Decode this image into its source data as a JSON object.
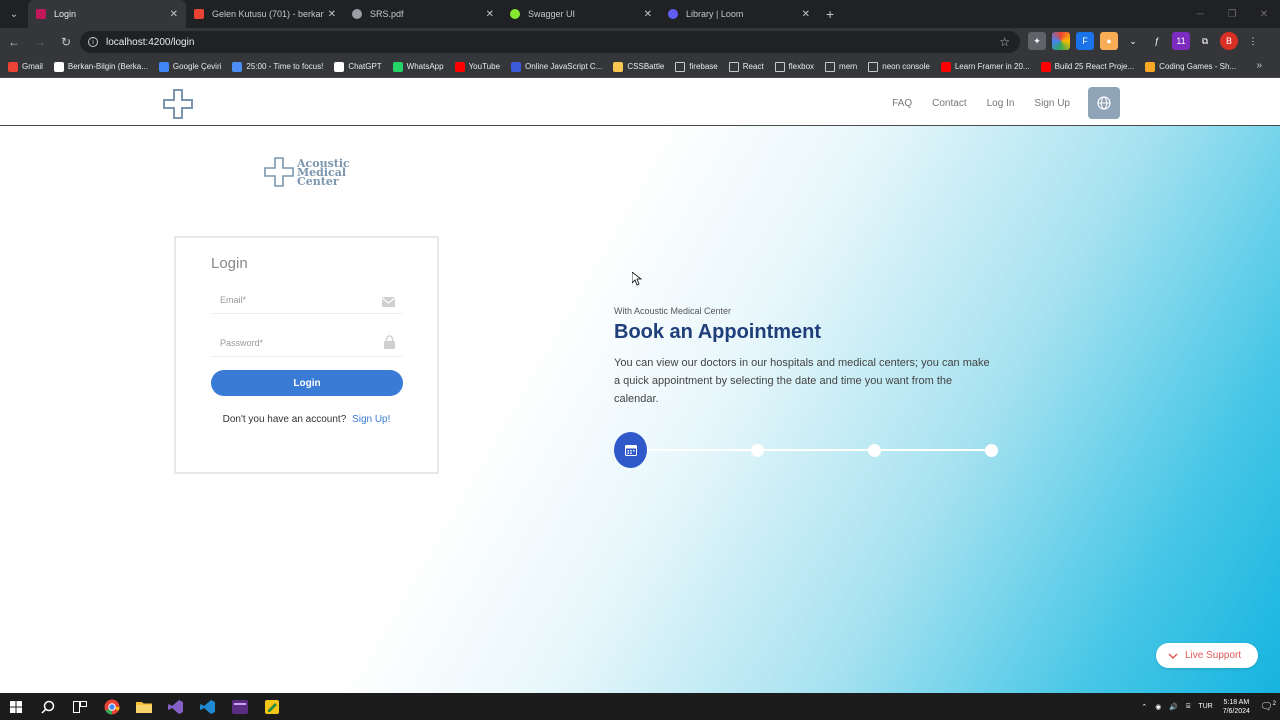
{
  "browser": {
    "tabs": [
      {
        "label": "Login",
        "color": "#c2185b",
        "active": true
      },
      {
        "label": "Gelen Kutusu (701) - berkan14...",
        "color": "#ea4335",
        "active": false
      },
      {
        "label": "SRS.pdf",
        "color": "#9aa0a6",
        "active": false
      },
      {
        "label": "Swagger UI",
        "color": "#85ea2d",
        "active": false
      },
      {
        "label": "Library | Loom",
        "color": "#625df5",
        "active": false
      }
    ],
    "url": "localhost:4200/login",
    "bookmarks": [
      {
        "label": "Gmail",
        "color": "#ea4335"
      },
      {
        "label": "Berkan-Bilgin (Berka...",
        "color": "#ffffff"
      },
      {
        "label": "Google Çeviri",
        "color": "#4285f4"
      },
      {
        "label": "25:00 - Time to focus!",
        "color": "#4c8df6"
      },
      {
        "label": "ChatGPT",
        "color": "#ffffff"
      },
      {
        "label": "WhatsApp",
        "color": "#25d366"
      },
      {
        "label": "YouTube",
        "color": "#ff0000"
      },
      {
        "label": "Online JavaScript C...",
        "color": "#3b5bdb"
      },
      {
        "label": "CSSBattle",
        "color": "#f9c74f"
      },
      {
        "label": "firebase",
        "color": "folder"
      },
      {
        "label": "React",
        "color": "folder"
      },
      {
        "label": "flexbox",
        "color": "folder"
      },
      {
        "label": "mern",
        "color": "folder"
      },
      {
        "label": "neon console",
        "color": "folder"
      },
      {
        "label": "Learn Framer in 20...",
        "color": "#ff0000"
      },
      {
        "label": "Build 25 React Proje...",
        "color": "#ff0000"
      },
      {
        "label": "Coding Games - Sh...",
        "color": "#f9a825"
      }
    ]
  },
  "site": {
    "nav": {
      "faq": "FAQ",
      "contact": "Contact",
      "login": "Log In",
      "signup": "Sign Up"
    },
    "brand": {
      "line1": "Acoustic",
      "line2": "Medical",
      "line3": "Center"
    },
    "login": {
      "title": "Login",
      "email_placeholder": "Email*",
      "password_placeholder": "Password*",
      "button": "Login",
      "no_account": "Don't you have an account?",
      "signup_link": "Sign Up!"
    },
    "hero": {
      "subtitle": "With Acoustic Medical Center",
      "title": "Book an Appointment",
      "description": "You can view our doctors in our hospitals and medical centers; you can make a quick appointment by selecting the date and time you want from the calendar."
    },
    "live_support": "Live Support"
  },
  "taskbar": {
    "lang": "TUR",
    "time": "5:18 AM",
    "date": "7/6/2024",
    "notifications": "2"
  },
  "colors": {
    "primary": "#3a7bd5",
    "title_blue": "#1f3e7a",
    "accent_red": "#e05a56",
    "logo_blue": "#7a95ad"
  }
}
